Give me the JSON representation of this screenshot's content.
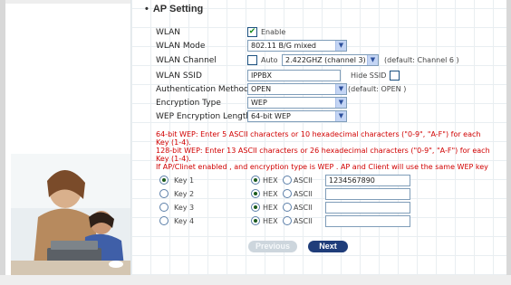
{
  "section_title": "AP Setting",
  "form": {
    "wlan": {
      "label": "WLAN",
      "checkbox_checked": true,
      "checkbox_label": "Enable"
    },
    "mode": {
      "label": "WLAN Mode",
      "value": "802.11 B/G mixed"
    },
    "channel": {
      "label": "WLAN Channel",
      "auto_label": "Auto",
      "value": "2.422GHZ (channel 3)",
      "hint": "(default: Channel 6 )"
    },
    "ssid": {
      "label": "WLAN SSID",
      "value": "IPPBX",
      "hide_label": "Hide SSID"
    },
    "auth": {
      "label": "Authentication Method",
      "value": "OPEN",
      "hint": "(default: OPEN )"
    },
    "encryption": {
      "label": "Encryption Type",
      "value": "WEP"
    },
    "wep_length": {
      "label": "WEP Encryption Length",
      "value": "64-bit WEP"
    }
  },
  "notes": {
    "line1": "64-bit WEP: Enter 5 ASCII characters or 10 hexadecimal characters (\"0-9\", \"A-F\") for each Key (1-4).",
    "line2": "128-bit WEP: Enter 13 ASCII characters or 26 hexadecimal characters (\"0-9\", \"A-F\") for each Key (1-4).",
    "line3": "If AP/Clinet enabled , and encryption type is WEP . AP and Client will use the same WEP key"
  },
  "keys": {
    "hex_label": "HEX",
    "ascii_label": "ASCII",
    "rows": [
      {
        "label": "Key 1",
        "selected": true,
        "value": "1234567890"
      },
      {
        "label": "Key 2",
        "selected": false,
        "value": ""
      },
      {
        "label": "Key 3",
        "selected": false,
        "value": ""
      },
      {
        "label": "Key 4",
        "selected": false,
        "value": ""
      }
    ]
  },
  "buttons": {
    "previous": "Previous",
    "next": "Next"
  },
  "colors": {
    "note_red": "#d10000",
    "next_button": "#1f3d7a",
    "accent_blue": "#7f9db9"
  }
}
